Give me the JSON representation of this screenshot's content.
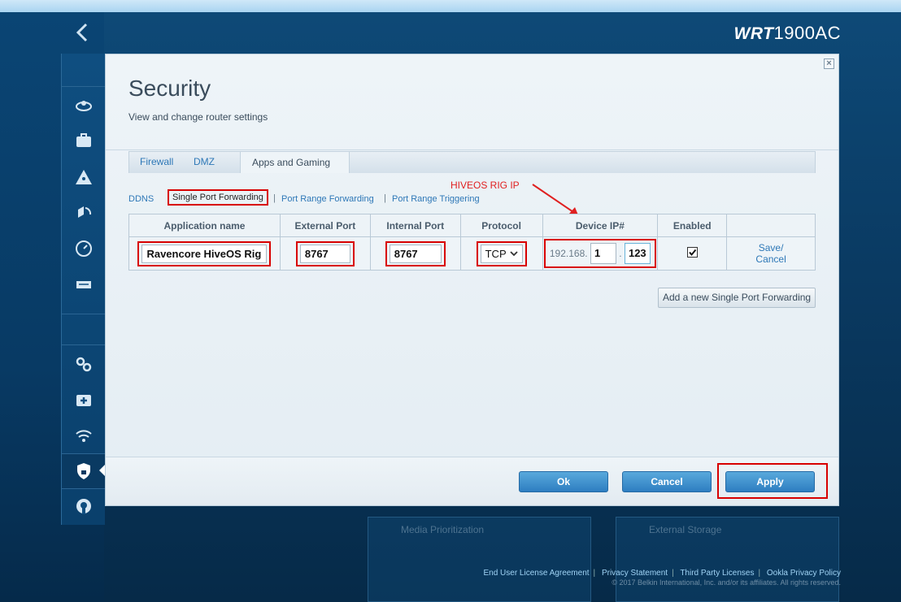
{
  "brand": {
    "bold": "WRT",
    "model": "1900AC"
  },
  "panel": {
    "title": "Security",
    "subtitle": "View and change router settings",
    "close_label": "×"
  },
  "tabs": [
    {
      "label": "Firewall"
    },
    {
      "label": "DMZ"
    },
    {
      "label": "Apps and Gaming",
      "active": true
    }
  ],
  "sub_links": [
    {
      "label": "DDNS"
    },
    {
      "label": "Single Port Forwarding",
      "active": true
    },
    {
      "label": "Port Range Forwarding"
    },
    {
      "label": "Port Range Triggering"
    }
  ],
  "annotation": "HIVEOS RIG IP",
  "table": {
    "headers": [
      "Application name",
      "External Port",
      "Internal Port",
      "Protocol",
      "Device IP#",
      "Enabled",
      ""
    ],
    "row": {
      "app_name": "Ravencore HiveOS Rig",
      "external_port": "8767",
      "internal_port": "8767",
      "protocol": "TCP",
      "ip_prefix": "192.168.",
      "ip_octet3": "1",
      "ip_dot": ".",
      "ip_octet4": "123",
      "enabled": true,
      "save_label": "Save/",
      "cancel_label": "Cancel"
    }
  },
  "add_button": "Add a new Single Port Forwarding",
  "buttons": {
    "ok": "Ok",
    "cancel": "Cancel",
    "apply": "Apply"
  },
  "bg_cards": [
    "Media Prioritization",
    "External Storage"
  ],
  "footer": {
    "links": [
      "End User License Agreement",
      "Privacy Statement",
      "Third Party Licenses",
      "Ookla Privacy Policy"
    ],
    "copyright": "© 2017 Belkin International, Inc. and/or its affiliates. All rights reserved."
  },
  "colors": {
    "accent": "#2e78b7",
    "highlight": "#d80000",
    "button": "#2e7ec1"
  }
}
